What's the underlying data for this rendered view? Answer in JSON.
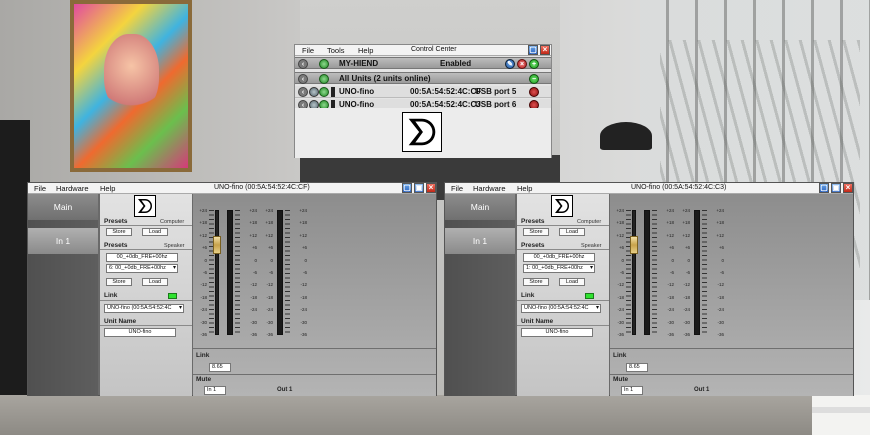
{
  "control_center": {
    "menu": [
      "File",
      "Tools",
      "Help"
    ],
    "title": "Control Center",
    "master_row": {
      "name": "MY-HIEND",
      "status": "Enabled"
    },
    "group_row": {
      "label": "All Units (2 units online)"
    },
    "units": [
      {
        "name": "UNO-fino",
        "mac": "00:5A:54:52:4C:CF",
        "port": "USB port 5"
      },
      {
        "name": "UNO-fino",
        "mac": "00:5A:54:52:4C:C3",
        "port": "USB port 6"
      }
    ]
  },
  "unit_windows": [
    {
      "menu": [
        "File",
        "Hardware",
        "Help"
      ],
      "title": "UNO-fino (00:5A:54:52:4C:CF)",
      "tabs": [
        "Main",
        "In 1"
      ],
      "presets": {
        "label": "Presets",
        "computer_label": "Computer",
        "store_label": "Store",
        "load_label": "Load",
        "speaker_label": "Speaker",
        "speaker_preset_name": "00_+0db_FRE+00hz",
        "speaker_preset_selected": "6: 00_+0db_FRE+00hz"
      },
      "link": {
        "label": "Link",
        "value": "UNO-fino (00:5A:54:52:4C"
      },
      "unit_name": {
        "label": "Unit Name",
        "value": "UNO-fino"
      },
      "mixer": {
        "scale": [
          "+24",
          "+18",
          "+12",
          "+6",
          "0",
          "-6",
          "-12",
          "-18",
          "-24",
          "-30",
          "-36"
        ],
        "link_label": "Link",
        "link_value": "8.65",
        "mute_label": "Mute",
        "input_label": "In 1",
        "output_label": "Out 1"
      }
    },
    {
      "menu": [
        "File",
        "Hardware",
        "Help"
      ],
      "title": "UNO-fino (00:5A:54:52:4C:C3)",
      "tabs": [
        "Main",
        "In 1"
      ],
      "presets": {
        "label": "Presets",
        "computer_label": "Computer",
        "store_label": "Store",
        "load_label": "Load",
        "speaker_label": "Speaker",
        "speaker_preset_name": "00_+0db_FRE+00hz",
        "speaker_preset_selected": "1: 00_+0db_FRE+00hz"
      },
      "link": {
        "label": "Link",
        "value": "UNO-fino (00:5A:54:52:4C"
      },
      "unit_name": {
        "label": "Unit Name",
        "value": "UNO-fino"
      },
      "mixer": {
        "scale": [
          "+24",
          "+18",
          "+12",
          "+6",
          "0",
          "-6",
          "-12",
          "-18",
          "-24",
          "-30",
          "-36"
        ],
        "link_label": "Link",
        "link_value": "8.65",
        "mute_label": "Mute",
        "input_label": "In 1",
        "output_label": "Out 1"
      }
    }
  ],
  "icons": {
    "back": "back-arrow-icon",
    "power": "power-icon",
    "gear": "gear-icon",
    "edit": "edit-icon",
    "delete": "delete-icon",
    "add": "add-icon",
    "logo": "speaker-logo-icon"
  },
  "colors": {
    "accent_green": "#2fe22f",
    "close_red": "#c02818",
    "max_blue": "#2c64c0"
  }
}
